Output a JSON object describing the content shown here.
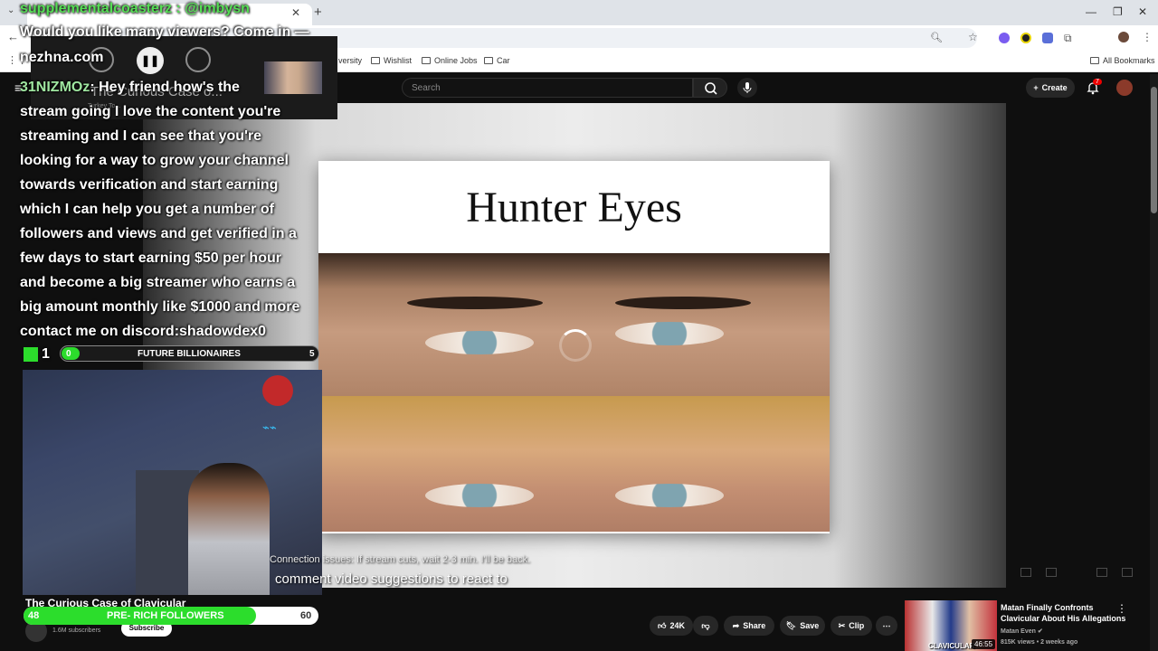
{
  "browser": {
    "bookmarks": [
      "versity",
      "Wishlist",
      "Online Jobs",
      "Car"
    ],
    "all_bookmarks": "All Bookmarks",
    "ext_badge_color": "#e53935"
  },
  "youtube": {
    "search_placeholder": "Search",
    "create_label": "Create",
    "notif_count": "7",
    "video_title": "The Curious Case of Clavicular",
    "subscribers": "1.6M subscribers",
    "subscribe_label": "Subscribe",
    "actions": {
      "likes": "24K",
      "share": "Share",
      "save": "Save",
      "clip": "Clip"
    },
    "slide_title": "Hunter Eyes",
    "connection_notice": "Connection issues: If stream cuts, wait 2-3 min. I'll be back.",
    "recommended": {
      "title": "Matan Finally Confronts Clavicular About His Allegations",
      "channel": "Matan Even",
      "meta": "815K views • 2 weeks ago",
      "duration": "46:55",
      "thumb_caption": "CLAVICULAR"
    }
  },
  "mini_player": {
    "title": "The Curious Case o...",
    "subtitle": "Turkey To..."
  },
  "overlay": {
    "alert_line1": "supplementalcoasterz : @imbysn",
    "alert_line2": "Would you like many viewers? Come in —",
    "alert_line3": "nezhna.com",
    "chat_user": "31NIZMOz",
    "chat_lines": [
      ": Hey friend how's the",
      "stream going I love the content you're",
      "streaming and I can see that you're",
      "looking for a way to grow your channel",
      "towards verification and start earning",
      "which I can help you get a number of",
      "followers and views and get verified in a",
      "few days to start earning $50 per hour",
      "and become a big streamer who earns a",
      "big amount monthly like $1000 and more",
      "contact me on discord:shadowdex0"
    ],
    "viewer_count": "1",
    "goal1": {
      "label": "FUTURE BILLIONAIRES",
      "current": "0",
      "target": "5",
      "progress": 0
    },
    "goal2": {
      "label": "PRE- RICH FOLLOWERS",
      "current": "48",
      "target": "60",
      "progress": 0.8
    },
    "caption": "comment video suggestions to react to",
    "accent_green": "#2cdd2c"
  }
}
